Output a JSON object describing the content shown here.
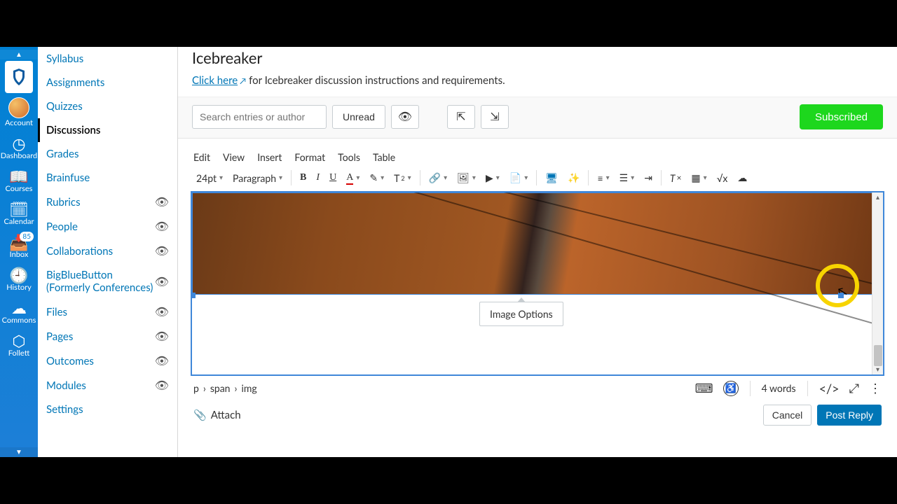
{
  "globalnav": {
    "account": "Account",
    "dashboard": "Dashboard",
    "courses": "Courses",
    "calendar": "Calendar",
    "inbox": "Inbox",
    "inbox_badge": "85",
    "history": "History",
    "commons": "Commons",
    "follett": "Follett"
  },
  "coursenav": [
    {
      "label": "Syllabus",
      "hidden": false
    },
    {
      "label": "Assignments",
      "hidden": false
    },
    {
      "label": "Quizzes",
      "hidden": false
    },
    {
      "label": "Discussions",
      "hidden": false,
      "active": true
    },
    {
      "label": "Grades",
      "hidden": false
    },
    {
      "label": "Brainfuse",
      "hidden": false
    },
    {
      "label": "Rubrics",
      "hidden": true
    },
    {
      "label": "People",
      "hidden": true
    },
    {
      "label": "Collaborations",
      "hidden": true
    },
    {
      "label": "BigBlueButton (Formerly Conferences)",
      "hidden": true
    },
    {
      "label": "Files",
      "hidden": true
    },
    {
      "label": "Pages",
      "hidden": true
    },
    {
      "label": "Outcomes",
      "hidden": true
    },
    {
      "label": "Modules",
      "hidden": true
    },
    {
      "label": "Settings",
      "hidden": false
    }
  ],
  "header": {
    "title": "Icebreaker",
    "link_text": "Click here",
    "instr_text": " for Icebreaker discussion instructions and requirements."
  },
  "discussion_tools": {
    "search_placeholder": "Search entries or author",
    "unread": "Unread",
    "subscribed": "Subscribed"
  },
  "rce": {
    "menu": [
      "Edit",
      "View",
      "Insert",
      "Format",
      "Tools",
      "Table"
    ],
    "fontsize": "24pt",
    "blocktype": "Paragraph",
    "image_popup": "Image Options",
    "breadcrumb": [
      "p",
      "span",
      "img"
    ],
    "wordcount": "4 words"
  },
  "footer": {
    "attach": "Attach",
    "cancel": "Cancel",
    "post": "Post Reply"
  },
  "icons": {
    "eye_off": "eye-off",
    "search": "search",
    "subscribe": "rss"
  }
}
